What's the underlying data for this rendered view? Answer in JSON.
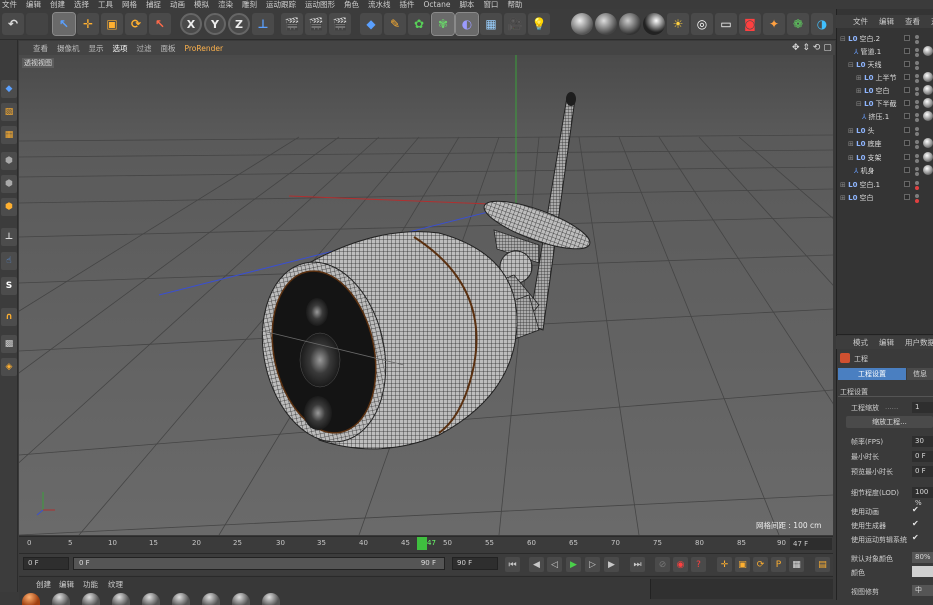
{
  "menu": [
    "文件",
    "编辑",
    "创建",
    "选择",
    "工具",
    "网格",
    "捕捉",
    "动画",
    "模拟",
    "渲染",
    "雕刻",
    "运动跟踪",
    "运动图形",
    "角色",
    "流水线",
    "插件",
    "Octane",
    "脚本",
    "窗口",
    "帮助"
  ],
  "toolbar": {
    "axis_x": "X",
    "axis_y": "Y",
    "axis_z": "Z"
  },
  "left_toolbar": {
    "snap_letter": "S"
  },
  "viewport": {
    "menu": [
      "查看",
      "摄像机",
      "显示",
      "选项",
      "过滤",
      "面板",
      "ProRender"
    ],
    "active_menu": "选项",
    "label": "透视视图",
    "grid_spacing": "网格间距 : 100 cm"
  },
  "timeline": {
    "ticks": [
      "0",
      "5",
      "10",
      "15",
      "20",
      "25",
      "30",
      "35",
      "40",
      "45",
      "50",
      "55",
      "60",
      "65",
      "70",
      "75",
      "80",
      "85",
      "90"
    ],
    "current_frame_marker": "47",
    "current_frame_field": "47 F"
  },
  "transport": {
    "start_field": "0 F",
    "range_start": "0 F",
    "range_end": "90 F",
    "end_field": "90 F"
  },
  "materials": {
    "tabs": [
      "创建",
      "编辑",
      "功能",
      "纹理"
    ]
  },
  "objects_panel": {
    "tabs": [
      "文件",
      "编辑",
      "查看",
      "对"
    ],
    "rows": [
      {
        "name": "空白.2",
        "prefix": "L0",
        "indent": 0
      },
      {
        "name": "管道.1",
        "prefix": "",
        "indent": 1
      },
      {
        "name": "天线",
        "prefix": "L0",
        "indent": 1
      },
      {
        "name": "上半节",
        "prefix": "L0",
        "indent": 2
      },
      {
        "name": "空白",
        "prefix": "L0",
        "indent": 2
      },
      {
        "name": "下半截",
        "prefix": "L0",
        "indent": 2
      },
      {
        "name": "挤压.1",
        "prefix": "",
        "indent": 3
      },
      {
        "name": "头",
        "prefix": "L0",
        "indent": 1
      },
      {
        "name": "底座",
        "prefix": "L0",
        "indent": 1
      },
      {
        "name": "支架",
        "prefix": "L0",
        "indent": 1
      },
      {
        "name": "机身",
        "prefix": "",
        "indent": 1
      },
      {
        "name": "空白.1",
        "prefix": "L0",
        "indent": 0
      },
      {
        "name": "空白",
        "prefix": "L0",
        "indent": 0
      }
    ]
  },
  "attributes_panel": {
    "tabs": [
      "模式",
      "编辑",
      "用户数据"
    ],
    "object_name": "工程",
    "tab_active": "工程设置",
    "tab_other": "信息",
    "section": "工程设置",
    "scale_label": "工程缩放",
    "scale_value": "1",
    "scale_button": "缩放工程...",
    "fps_label": "帧率(FPS)",
    "fps_value": "30",
    "min_len_label": "最小时长",
    "min_len_value": "0 F",
    "preview_min_label": "预览最小时长",
    "preview_min_value": "0 F",
    "lod_label": "细节程度(LOD)",
    "lod_value": "100 %",
    "use_anim_label": "使用动画",
    "use_gen_label": "使用生成器",
    "use_motion_label": "使用运动剪辑系统",
    "default_color_label": "默认对象颜色",
    "default_color_value": "80%",
    "color_label": "颜色",
    "view_clip_label": "视图修剪",
    "view_clip_value": "中",
    "check": "✔"
  },
  "colors": {
    "accent_blue": "#4a7fc1",
    "playhead_green": "#3fbf3f",
    "prorender_orange": "#ffb34d"
  }
}
